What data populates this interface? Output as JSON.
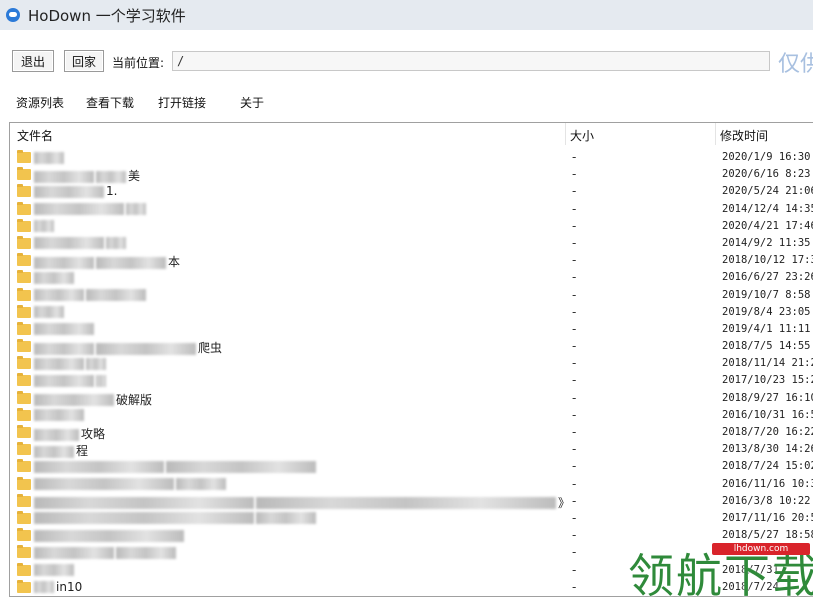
{
  "window": {
    "title": "HoDown 一个学习软件"
  },
  "toolbar": {
    "logout_label": "退出",
    "home_label": "回家",
    "location_label": "当前位置:",
    "path_value": "/",
    "watermark": "仅供"
  },
  "menu": [
    "资源列表",
    "查看下载",
    "打开链接",
    "关于"
  ],
  "list": {
    "headers": {
      "name": "文件名",
      "size": "大小",
      "mtime": "修改时间"
    },
    "rows": [
      {
        "name_visible": "",
        "size": "-",
        "mtime": "2020/1/9 16:30:"
      },
      {
        "name_visible": "美",
        "size": "-",
        "mtime": "2020/6/16 8:23:"
      },
      {
        "name_visible": "1.",
        "size": "-",
        "mtime": "2020/5/24 21:06"
      },
      {
        "name_visible": "",
        "size": "-",
        "mtime": "2014/12/4 14:35"
      },
      {
        "name_visible": "",
        "size": "-",
        "mtime": "2020/4/21 17:46"
      },
      {
        "name_visible": "",
        "size": "-",
        "mtime": "2014/9/2 11:35:"
      },
      {
        "name_visible": "本",
        "size": "-",
        "mtime": "2018/10/12 17:3"
      },
      {
        "name_visible": "",
        "size": "-",
        "mtime": "2016/6/27 23:26"
      },
      {
        "name_visible": "",
        "size": "-",
        "mtime": "2019/10/7 8:58:"
      },
      {
        "name_visible": "",
        "size": "-",
        "mtime": "2019/8/4 23:05:"
      },
      {
        "name_visible": "",
        "size": "-",
        "mtime": "2019/4/1 11:11:"
      },
      {
        "name_visible": "爬虫",
        "size": "-",
        "mtime": "2018/7/5 14:55:"
      },
      {
        "name_visible": "",
        "size": "-",
        "mtime": "2018/11/14 21:2"
      },
      {
        "name_visible": "",
        "size": "-",
        "mtime": "2017/10/23 15:2"
      },
      {
        "name_visible": "破解版",
        "size": "-",
        "mtime": "2018/9/27 16:10"
      },
      {
        "name_visible": "",
        "size": "-",
        "mtime": "2016/10/31 16:5"
      },
      {
        "name_visible": "攻略",
        "size": "-",
        "mtime": "2018/7/20 16:22"
      },
      {
        "name_visible": "程",
        "size": "-",
        "mtime": "2013/8/30 14:26"
      },
      {
        "name_visible": "",
        "size": "-",
        "mtime": "2018/7/24 15:02"
      },
      {
        "name_visible": "",
        "size": "-",
        "mtime": "2016/11/16 10:3"
      },
      {
        "name_visible": "》",
        "size": "-",
        "mtime": "2016/3/8 10:22:"
      },
      {
        "name_visible": "",
        "size": "-",
        "mtime": "2017/11/16 20:5"
      },
      {
        "name_visible": "",
        "size": "-",
        "mtime": "2018/5/27 18:58"
      },
      {
        "name_visible": "",
        "size": "-",
        "mtime": "201"
      },
      {
        "name_visible": "",
        "size": "-",
        "mtime": "2018/7/31"
      },
      {
        "name_visible": "in10",
        "size": "-",
        "mtime": "2018/7/24"
      }
    ]
  },
  "watermark": {
    "badge": "lhdown.com",
    "text": "领航下载"
  },
  "icons": {
    "app": "cloud-icon",
    "folder": "folder-icon"
  },
  "colors": {
    "titlebar": "#e5eaf0",
    "folder": "#f2c44e",
    "accent": "#2b7ad8"
  }
}
